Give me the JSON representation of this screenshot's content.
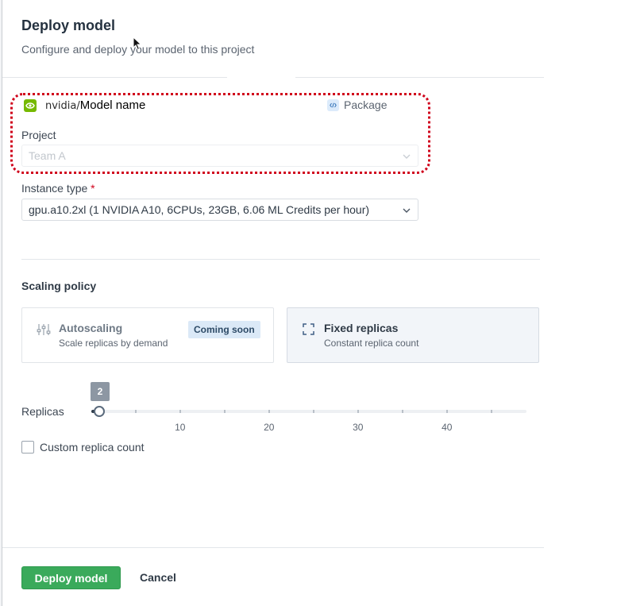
{
  "header": {
    "title": "Deploy model",
    "subtitle": "Configure and deploy your model to this project"
  },
  "model": {
    "org": "nvidia/",
    "name": "Model name",
    "package_label": "Package",
    "logo_icon": "nvidia-logo",
    "package_icon": "code-icon"
  },
  "project": {
    "label": "Project",
    "value": "Team A"
  },
  "instance": {
    "label": "Instance type",
    "required_mark": "*",
    "value": "gpu.a10.2xl (1 NVIDIA A10, 6CPUs, 23GB, 6.06 ML Credits per hour)"
  },
  "scaling": {
    "title": "Scaling policy",
    "options": [
      {
        "title": "Autoscaling",
        "description": "Scale replicas by demand",
        "badge": "Coming soon",
        "icon": "sliders-icon"
      },
      {
        "title": "Fixed replicas",
        "description": "Constant replica count",
        "icon": "expand-icon"
      }
    ],
    "selected": "Fixed replicas"
  },
  "replicas": {
    "label": "Replicas",
    "value": 2,
    "value_label": "2",
    "tick_labels": [
      "10",
      "20",
      "30",
      "40"
    ],
    "custom_checkbox_label": "Custom replica count",
    "custom_checked": false
  },
  "footer": {
    "deploy_label": "Deploy model",
    "cancel_label": "Cancel"
  },
  "colors": {
    "primary": "#3aaa5b",
    "highlight_outline": "#d0021b",
    "nvidia_green": "#76b900",
    "required": "#d0021b"
  }
}
